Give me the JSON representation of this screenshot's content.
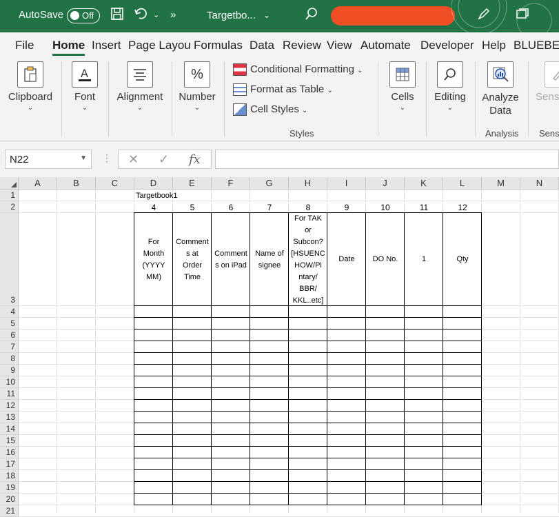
{
  "titlebar": {
    "autosave_label": "AutoSave",
    "autosave_state": "Off",
    "filename": "Targetbo...",
    "accent": "#217346"
  },
  "tabs": [
    "File",
    "Home",
    "Insert",
    "Page Layou",
    "Formulas",
    "Data",
    "Review",
    "View",
    "Automate",
    "Developer",
    "Help",
    "BLUEBEA"
  ],
  "ribbon": {
    "clipboard": "Clipboard",
    "font": "Font",
    "alignment": "Alignment",
    "number": "Number",
    "conditional_formatting": "Conditional Formatting",
    "format_as_table": "Format as Table",
    "cell_styles": "Cell Styles",
    "styles_group": "Styles",
    "cells": "Cells",
    "editing": "Editing",
    "analyze_data_line1": "Analyze",
    "analyze_data_line2": "Data",
    "analysis_group": "Analysis",
    "sensitivity": "Sensi",
    "sensitivity_group": "Sensi"
  },
  "formula_bar": {
    "name_box": "N22",
    "fx": "fx",
    "cancel": "✕",
    "enter": "✓",
    "value": ""
  },
  "columns": [
    "A",
    "B",
    "C",
    "D",
    "E",
    "F",
    "G",
    "H",
    "I",
    "J",
    "K",
    "L",
    "M",
    "N"
  ],
  "rows": [
    "1",
    "2",
    "3",
    "4",
    "5",
    "6",
    "7",
    "8",
    "9",
    "10",
    "11",
    "12",
    "13",
    "14",
    "15",
    "16",
    "17",
    "18",
    "19",
    "20",
    "21"
  ],
  "sheet": {
    "d1": "Targetbook1",
    "row2": [
      "4",
      "5",
      "6",
      "7",
      "8",
      "9",
      "10",
      "11",
      "12"
    ],
    "headers": [
      [
        "For",
        "Month",
        "(YYYY",
        "MM)"
      ],
      [
        "Comment",
        "s at",
        "Order",
        "Time"
      ],
      [
        "Comment",
        "s on iPad"
      ],
      [
        "Name of",
        "signee"
      ],
      [
        "For TAK",
        "or",
        "Subcon?",
        "[HSUENC",
        "HOW/Pi",
        "ntary/",
        "BBR/",
        "KKL..etc]"
      ],
      [
        "Date"
      ],
      [
        "DO No."
      ],
      [
        "1"
      ],
      [
        "Qty"
      ]
    ]
  }
}
